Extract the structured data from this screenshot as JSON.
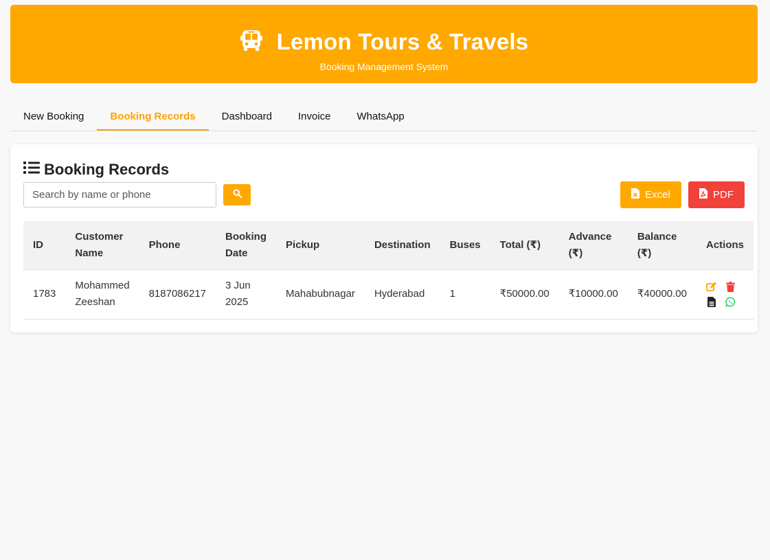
{
  "header": {
    "title": "Lemon Tours & Travels",
    "subtitle": "Booking Management System",
    "icon": "bus-icon"
  },
  "tabs": [
    {
      "label": "New Booking",
      "active": false
    },
    {
      "label": "Booking Records",
      "active": true
    },
    {
      "label": "Dashboard",
      "active": false
    },
    {
      "label": "Invoice",
      "active": false
    },
    {
      "label": "WhatsApp",
      "active": false
    }
  ],
  "records": {
    "title": "Booking Records",
    "search": {
      "placeholder": "Search by name or phone",
      "value": ""
    },
    "excel_label": "Excel",
    "pdf_label": "PDF",
    "columns": {
      "id": "ID",
      "customer": [
        "Customer",
        "Name"
      ],
      "phone": "Phone",
      "date": [
        "Booking",
        "Date"
      ],
      "pickup": "Pickup",
      "destination": "Destination",
      "buses": "Buses",
      "total": "Total (₹)",
      "advance": [
        "Advance",
        "(₹)"
      ],
      "balance": [
        "Balance",
        "(₹)"
      ],
      "actions": "Actions"
    },
    "rows": [
      {
        "id": "1783",
        "customer": [
          "Mohammed",
          "Zeeshan"
        ],
        "phone": "8187086217",
        "date": [
          "3 Jun",
          "2025"
        ],
        "pickup": "Mahabubnagar",
        "destination": "Hyderabad",
        "buses": "1",
        "total": "₹50000.00",
        "advance": "₹10000.00",
        "balance": "₹40000.00"
      }
    ]
  },
  "colors": {
    "accent": "#ffa800",
    "danger": "#f2403a",
    "whatsapp": "#25d366"
  }
}
